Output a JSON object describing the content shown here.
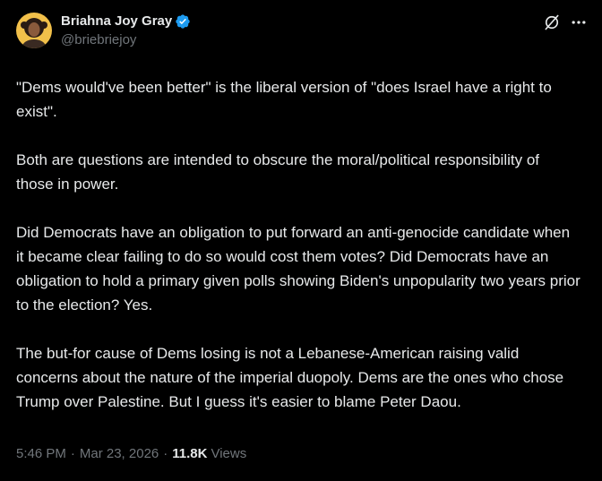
{
  "author": {
    "name": "Briahna Joy Gray",
    "handle": "@briebriejoy",
    "verified": true,
    "verified_color": "#1d9bf0"
  },
  "icons": [
    "verified-badge-icon",
    "grok-icon",
    "more-options-icon"
  ],
  "tweet": {
    "paragraphs": [
      "\"Dems would've been better\" is the liberal version of \"does Israel have a right to exist\".",
      "Both are questions are intended to obscure the moral/political responsibility of those in power.",
      "Did Democrats have an obligation to put forward an anti-genocide candidate when it became clear failing to do so would cost them votes? Did Democrats have an obligation to hold a primary given polls showing Biden's unpopularity two years prior to the election? Yes.",
      "The but-for cause of Dems losing is not a Lebanese-American raising valid concerns about the nature of the imperial duopoly. Dems are the ones who chose Trump over Palestine. But I guess it's easier to blame Peter Daou."
    ]
  },
  "meta": {
    "time": "5:46 PM",
    "date": "Mar 23, 2026",
    "separator": "·",
    "views_count": "11.8K",
    "views_label": "Views"
  },
  "colors": {
    "background": "#000000",
    "text": "#e7e9ea",
    "secondary": "#71767b",
    "accent": "#1d9bf0"
  }
}
